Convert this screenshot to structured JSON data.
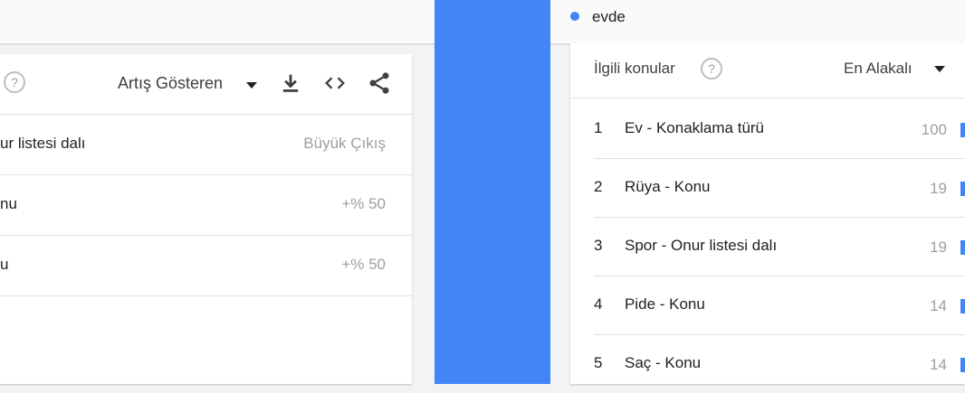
{
  "left_panel": {
    "help_symbol": "?",
    "sort_label": "Artış Gösteren",
    "icons": [
      "download-icon",
      "embed-code-icon",
      "share-icon"
    ],
    "rows": [
      {
        "label": "ur listesi dalı",
        "value": "Büyük Çıkış"
      },
      {
        "label": "nu",
        "value": "+% 50"
      },
      {
        "label": "u",
        "value": "+% 50"
      }
    ]
  },
  "right_panel": {
    "legend_term": "evde",
    "legend_color": "#4285f4",
    "title": "İlgili konular",
    "help_symbol": "?",
    "sort_label": "En Alakalı",
    "rows": [
      {
        "rank": "1",
        "topic": "Ev - Konaklama türü",
        "score": "100"
      },
      {
        "rank": "2",
        "topic": "Rüya - Konu",
        "score": "19"
      },
      {
        "rank": "3",
        "topic": "Spor - Onur listesi dalı",
        "score": "19"
      },
      {
        "rank": "4",
        "topic": "Pide - Konu",
        "score": "14"
      },
      {
        "rank": "5",
        "topic": "Saç - Konu",
        "score": "14"
      }
    ]
  },
  "colors": {
    "accent": "#4285f4",
    "divider": "#4285f4"
  }
}
